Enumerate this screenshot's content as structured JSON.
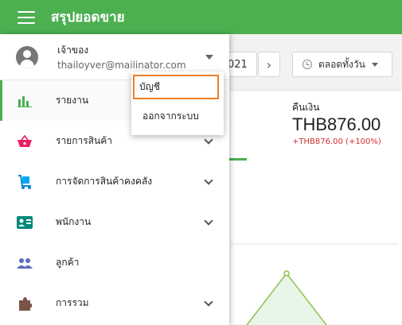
{
  "appbar": {
    "title": "สรุปยอดขาย",
    "menu_icon": "hamburger-icon",
    "color": "#4caf50"
  },
  "toolbar": {
    "date_value": "021",
    "next_label": "›",
    "range_label": "ตลอดทั้งวัน",
    "range_icon": "clock-icon"
  },
  "metric": {
    "label": "คืนเงิน",
    "value": "THB876.00",
    "delta": "+THB876.00 (+100%)",
    "delta_color": "#d32f2f"
  },
  "chart_data": {
    "type": "area",
    "series": [
      {
        "values": [
          0,
          1,
          0
        ]
      }
    ],
    "color": "#4caf50"
  },
  "account": {
    "name": "เจ้าของ",
    "email": "thailoyver@mailinator.com",
    "avatar_icon": "account-circle-icon"
  },
  "nav": {
    "items": [
      {
        "label": "รายงาน",
        "icon": "bar-chart-icon",
        "active": true,
        "expandable": false
      },
      {
        "label": "รายการสินค้า",
        "icon": "basket-icon",
        "active": false,
        "expandable": true
      },
      {
        "label": "การจัดการสินค้าคงคลัง",
        "icon": "dolly-icon",
        "active": false,
        "expandable": true
      },
      {
        "label": "พนักงาน",
        "icon": "badge-icon",
        "active": false,
        "expandable": true
      },
      {
        "label": "ลูกค้า",
        "icon": "people-icon",
        "active": false,
        "expandable": false
      },
      {
        "label": "การรวม",
        "icon": "puzzle-icon",
        "active": false,
        "expandable": true
      }
    ]
  },
  "popup": {
    "items": [
      "บัญชี",
      "ออกจากระบบ"
    ],
    "highlight_color": "#ef7d22"
  }
}
